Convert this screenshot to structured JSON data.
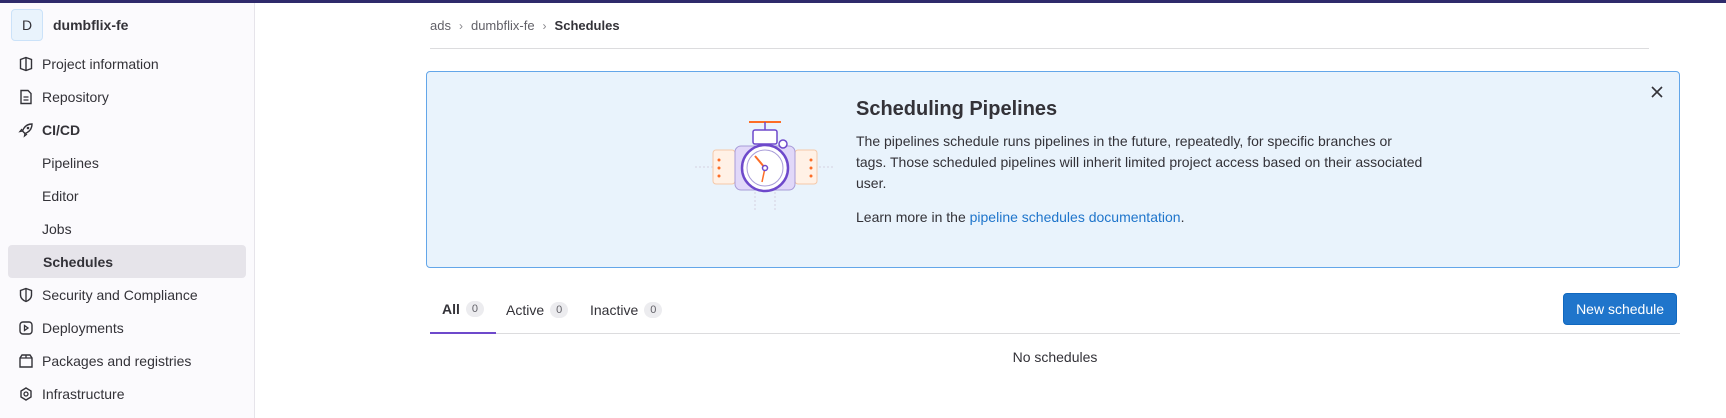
{
  "sidebar": {
    "project_avatar_letter": "D",
    "project_name": "dumbflix-fe",
    "items": [
      {
        "label": "Project information",
        "icon": "project-info-icon"
      },
      {
        "label": "Repository",
        "icon": "document-icon"
      },
      {
        "label": "CI/CD",
        "icon": "rocket-icon"
      },
      {
        "label": "Security and Compliance",
        "icon": "shield-icon"
      },
      {
        "label": "Deployments",
        "icon": "deployments-icon"
      },
      {
        "label": "Packages and registries",
        "icon": "package-icon"
      },
      {
        "label": "Infrastructure",
        "icon": "infrastructure-icon"
      }
    ],
    "cicd_sub": [
      {
        "label": "Pipelines"
      },
      {
        "label": "Editor"
      },
      {
        "label": "Jobs"
      },
      {
        "label": "Schedules",
        "active": true
      }
    ]
  },
  "breadcrumb": [
    "ads",
    "dumbflix-fe",
    "Schedules"
  ],
  "banner": {
    "title": "Scheduling Pipelines",
    "body": "The pipelines schedule runs pipelines in the future, repeatedly, for specific branches or tags. Those scheduled pipelines will inherit limited project access based on their associated user.",
    "learn_prefix": "Learn more in the ",
    "learn_link": "pipeline schedules documentation",
    "learn_suffix": "."
  },
  "tabs": [
    {
      "label": "All",
      "count": "0",
      "active": true
    },
    {
      "label": "Active",
      "count": "0"
    },
    {
      "label": "Inactive",
      "count": "0"
    }
  ],
  "new_schedule_label": "New schedule",
  "empty_text": "No schedules",
  "colors": {
    "accent": "#1f75cb",
    "tab_active": "#6e49cb",
    "banner_bg": "#e9f3fc"
  }
}
